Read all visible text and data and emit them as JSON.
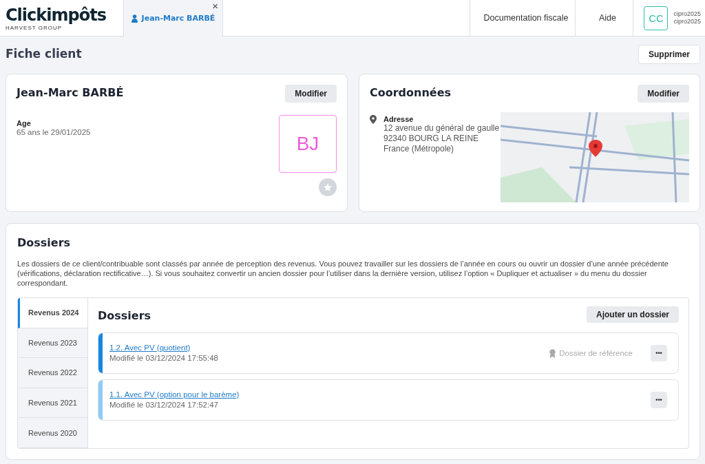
{
  "header": {
    "logo": "Clickimpôts",
    "logo_sub": "HARVEST GROUP",
    "tabs": [
      {
        "label": "Jean-Marc BARBÉ",
        "selected": true,
        "close": "×"
      }
    ],
    "nav": [
      "Documentation fiscale",
      "Aide"
    ],
    "user": {
      "initials": "CC",
      "line1": "cipro2025",
      "line2": "cipro2025"
    }
  },
  "page": {
    "title": "Fiche client",
    "delete_button": "Supprimer"
  },
  "client_card": {
    "name": "Jean-Marc BARBÉ",
    "edit_button": "Modifier",
    "age_label": "Age",
    "age_value": "65 ans le 29/01/2025",
    "avatar": "BJ",
    "favorite": false
  },
  "contact_card": {
    "title": "Coordonnées",
    "edit_button": "Modifier",
    "address_label": "Adresse",
    "address_lines": [
      "12 avenue du général de gaulle",
      "92340 BOURG LA REINE",
      "France (Métropole)"
    ]
  },
  "dossiers": {
    "title": "Dossiers",
    "description": "Les dossiers de ce client/contribuable sont classés par année de perception des revenus. Vous pouvez travailler sur les dossiers de l’année en cours ou ouvrir un dossier d’une année précédente (vérifications, déclaration rectificative…). Si vous souhaitez convertir un ancien dossier pour l’utiliser dans la dernière version, utilisez l’option « Dupliquer et actualiser » du menu du dossier correspondant.",
    "years": [
      {
        "label": "Revenus 2024",
        "selected": true
      },
      {
        "label": "Revenus 2023",
        "selected": false
      },
      {
        "label": "Revenus 2022",
        "selected": false
      },
      {
        "label": "Revenus 2021",
        "selected": false
      },
      {
        "label": "Revenus 2020",
        "selected": false
      }
    ],
    "panel_title": "Dossiers",
    "add_button": "Ajouter un dossier",
    "items": [
      {
        "name": "1.2. Avec PV (quotient)",
        "modified": "Modifié le 03/12/2024 17:55:48",
        "color": "#1587e0",
        "reference": "Dossier de référence",
        "menu": "•••"
      },
      {
        "name": "1.1. Avec PV (option pour le barème)",
        "modified": "Modifié le 03/12/2024 17:52:47",
        "color": "#8fcbf6",
        "menu": "•••"
      }
    ]
  }
}
